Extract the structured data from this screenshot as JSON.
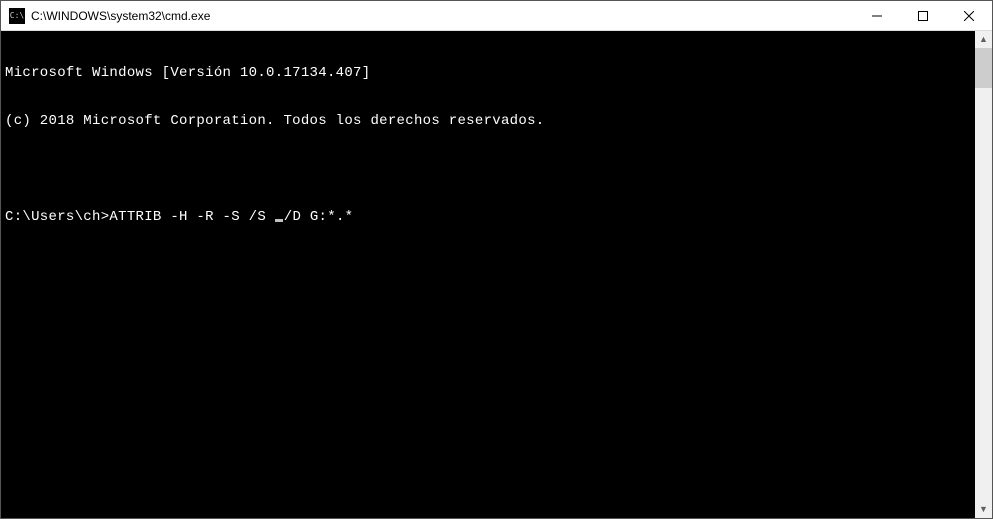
{
  "window": {
    "icon_text": "C:\\",
    "title": "C:\\WINDOWS\\system32\\cmd.exe"
  },
  "terminal": {
    "line1": "Microsoft Windows [Versión 10.0.17134.407]",
    "line2": "(c) 2018 Microsoft Corporation. Todos los derechos reservados.",
    "line3": "",
    "prompt": "C:\\Users\\ch>",
    "command_before_cursor": "ATTRIB -H -R -S /S ",
    "command_after_cursor": "/D G:*.*"
  }
}
